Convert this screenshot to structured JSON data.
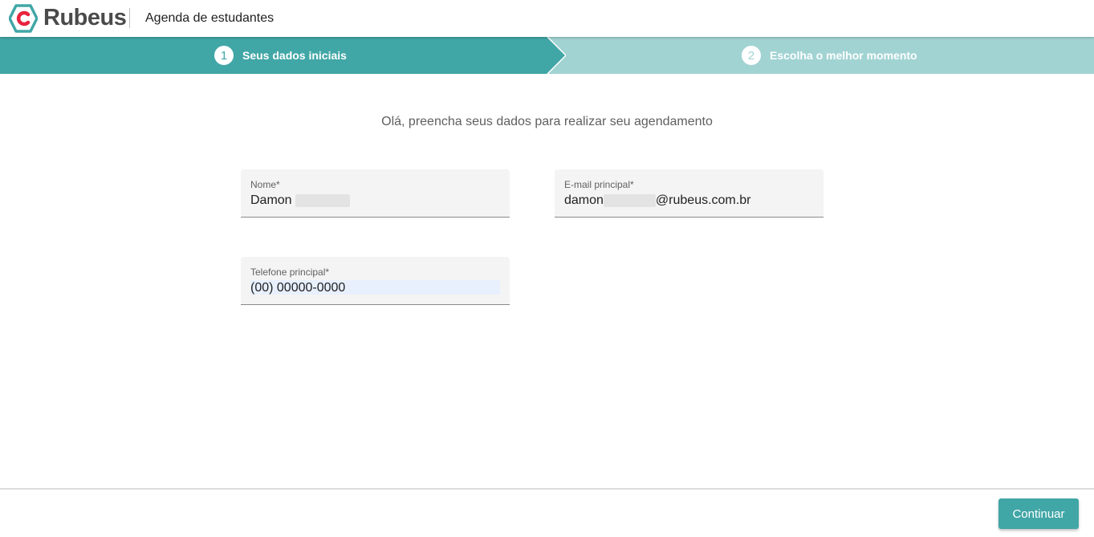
{
  "header": {
    "logo_text": "Rubeus",
    "app_title": "Agenda de estudantes",
    "logo_icon": "rubeus-hexagon-logo-icon"
  },
  "stepper": {
    "steps": [
      {
        "number": "1",
        "label": "Seus dados iniciais",
        "active": true
      },
      {
        "number": "2",
        "label": "Escolha o melhor momento",
        "active": false
      }
    ]
  },
  "form": {
    "intro": "Olá, preencha seus dados para realizar seu agendamento",
    "fields": {
      "nome": {
        "label": "Nome*",
        "value_prefix": "Damon",
        "value_suffix": ""
      },
      "email": {
        "label": "E-mail principal*",
        "value_prefix": "damon",
        "value_suffix": "@rubeus.com.br"
      },
      "telefone": {
        "label": "Telefone principal*",
        "value": "(00) 00000-0000"
      }
    }
  },
  "footer": {
    "continue_label": "Continuar"
  },
  "colors": {
    "primary": "#41a6a6",
    "primary_light": "#a2d3d3",
    "logo_red": "#e8243f"
  }
}
